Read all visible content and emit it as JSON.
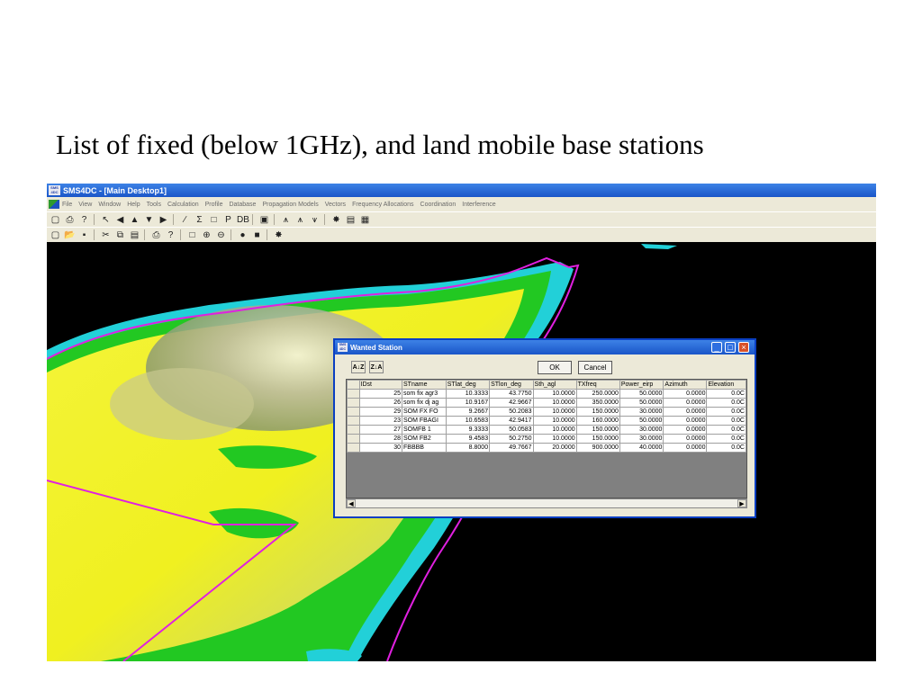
{
  "slide": {
    "title": "List of fixed (below 1GHz), and land mobile base stations"
  },
  "app": {
    "title": "SMS4DC - [Main Desktop1]",
    "icon_text": "SMS 4DC",
    "menu": [
      "File",
      "View",
      "Window",
      "Help",
      "Tools",
      "Calculation",
      "Profile",
      "Database",
      "Propagation Models",
      "Vectors",
      "Frequency Allocations",
      "Coordination",
      "Interference"
    ],
    "toolbar1_icons": [
      "new-doc-icon",
      "print-icon",
      "help-icon",
      "pointer-icon",
      "arrow-left-icon",
      "arrow-up-icon",
      "arrow-down-icon",
      "arrow-right-icon",
      "line-icon",
      "sigma-icon",
      "rectangle-icon",
      "pdf-icon",
      "db-icon",
      "image-icon",
      "tower-icon",
      "tower-multi-icon",
      "antenna-icon",
      "sun-icon",
      "window-icon",
      "palette-icon"
    ],
    "toolbar1_glyphs": [
      "▢",
      "⎙",
      "?",
      "↖",
      "◀",
      "▲",
      "▼",
      "▶",
      "∕",
      "Σ",
      "□",
      "P",
      "DB",
      "▣",
      "⩚",
      "⩚",
      "⩛",
      "✸",
      "▤",
      "▦"
    ],
    "toolbar2_icons": [
      "new-doc-icon",
      "open-folder-icon",
      "save-icon",
      "cut-icon",
      "copy-icon",
      "paste-icon",
      "print-icon",
      "help-icon",
      "rectangle-icon",
      "zoom-in-icon",
      "zoom-out-icon",
      "circle-icon",
      "stop-icon",
      "sun-icon"
    ],
    "toolbar2_glyphs": [
      "▢",
      "📂",
      "▪",
      "✂",
      "⧉",
      "▤",
      "⎙",
      "?",
      "□",
      "⊕",
      "⊖",
      "●",
      "■",
      "✸"
    ]
  },
  "dialog": {
    "title": "Wanted Station",
    "icon_text": "SMS 4DC",
    "sort_asc": "A↓Z",
    "sort_desc": "Z↓A",
    "ok_label": "OK",
    "cancel_label": "Cancel",
    "minimize": "_",
    "maximize": "□",
    "close": "×",
    "scroll_left": "◀",
    "scroll_right": "▶",
    "table": {
      "headers": [
        "IDst",
        "STname",
        "STlat_deg",
        "STlon_deg",
        "Sth_agl",
        "TXfreq",
        "Power_eirp",
        "Azimuth",
        "Elevation"
      ],
      "rows": [
        [
          "25",
          "som fix agr3",
          "10.3333",
          "43.7750",
          "10.0000",
          "250.0000",
          "50.0000",
          "0.0000",
          "0.0C"
        ],
        [
          "26",
          "som fix dj ag",
          "10.9167",
          "42.9667",
          "10.0000",
          "350.0000",
          "50.0000",
          "0.0000",
          "0.0C"
        ],
        [
          "29",
          "SOM FX FO",
          "9.2667",
          "50.2083",
          "10.0000",
          "150.0000",
          "30.0000",
          "0.0000",
          "0.0C"
        ],
        [
          "23",
          "SOM FBAGI",
          "10.6583",
          "42.9417",
          "10.0000",
          "160.0000",
          "50.0000",
          "0.0000",
          "0.0C"
        ],
        [
          "27",
          "SOMFB 1",
          "9.3333",
          "50.0583",
          "10.0000",
          "150.0000",
          "30.0000",
          "0.0000",
          "0.0C"
        ],
        [
          "28",
          "SOM FB2",
          "9.4583",
          "50.2750",
          "10.0000",
          "150.0000",
          "30.0000",
          "0.0000",
          "0.0C"
        ],
        [
          "30",
          "FBBBB",
          "8.8000",
          "49.7667",
          "20.0000",
          "900.0000",
          "40.0000",
          "0.0000",
          "0.0C"
        ]
      ]
    }
  }
}
